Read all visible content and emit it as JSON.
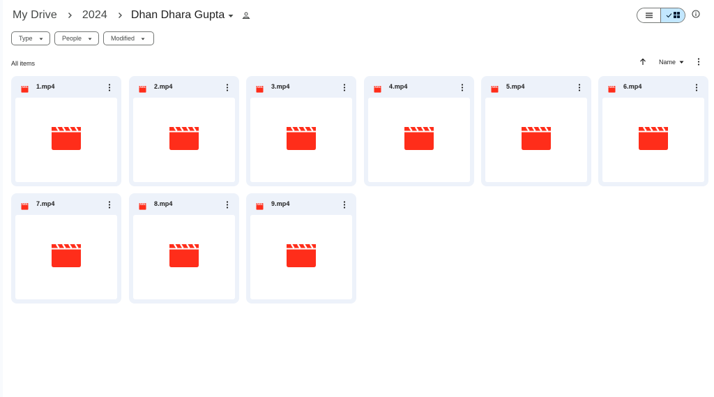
{
  "breadcrumb": {
    "root": "My Drive",
    "year": "2024",
    "current": "Dhan Dhara Gupta"
  },
  "filters": {
    "type": "Type",
    "people": "People",
    "modified": "Modified"
  },
  "section": {
    "label": "All items",
    "sort_label": "Name"
  },
  "icons": {
    "separator": "chevron-right-icon",
    "folder_menu": "caret-down-icon",
    "shared": "shared-folder-icon",
    "list_view": "list-view-icon",
    "grid_view": "grid-view-icon",
    "info": "info-icon",
    "sort": "arrow-up-icon",
    "more": "more-vertical-icon",
    "file": "video-file-icon"
  },
  "colors": {
    "video_red": "#ff2d1a",
    "card_bg": "#edf2fa",
    "toggle_active": "#c2e7ff"
  },
  "view_mode": "grid",
  "files": [
    {
      "name": "1.mp4"
    },
    {
      "name": "2.mp4"
    },
    {
      "name": "3.mp4"
    },
    {
      "name": "4.mp4"
    },
    {
      "name": "5.mp4"
    },
    {
      "name": "6.mp4"
    },
    {
      "name": "7.mp4"
    },
    {
      "name": "8.mp4"
    },
    {
      "name": "9.mp4"
    }
  ]
}
